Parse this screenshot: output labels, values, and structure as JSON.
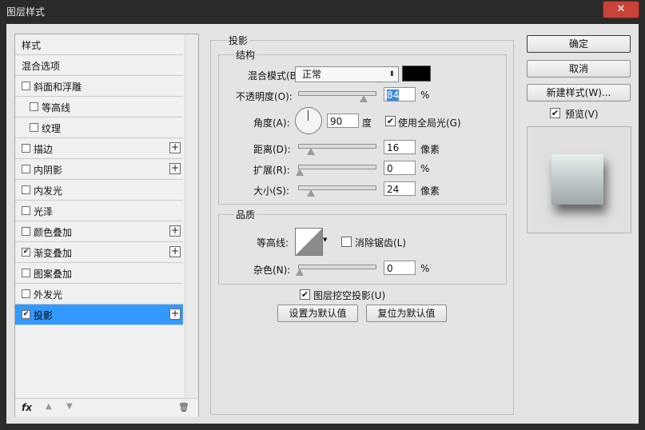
{
  "window": {
    "title": "图层样式",
    "close_label": "✕"
  },
  "left_panel": {
    "items": [
      {
        "label": "样式",
        "checkbox": false,
        "checked": false,
        "plus": false,
        "indent": 0,
        "selected": false
      },
      {
        "label": "混合选项",
        "checkbox": false,
        "checked": false,
        "plus": false,
        "indent": 0,
        "selected": false
      },
      {
        "label": "斜面和浮雕",
        "checkbox": true,
        "checked": false,
        "plus": false,
        "indent": 0,
        "selected": false
      },
      {
        "label": "等高线",
        "checkbox": true,
        "checked": false,
        "plus": false,
        "indent": 1,
        "selected": false
      },
      {
        "label": "纹理",
        "checkbox": true,
        "checked": false,
        "plus": false,
        "indent": 1,
        "selected": false
      },
      {
        "label": "描边",
        "checkbox": true,
        "checked": false,
        "plus": true,
        "indent": 0,
        "selected": false
      },
      {
        "label": "内阴影",
        "checkbox": true,
        "checked": false,
        "plus": true,
        "indent": 0,
        "selected": false
      },
      {
        "label": "内发光",
        "checkbox": true,
        "checked": false,
        "plus": false,
        "indent": 0,
        "selected": false
      },
      {
        "label": "光泽",
        "checkbox": true,
        "checked": false,
        "plus": false,
        "indent": 0,
        "selected": false
      },
      {
        "label": "颜色叠加",
        "checkbox": true,
        "checked": false,
        "plus": true,
        "indent": 0,
        "selected": false
      },
      {
        "label": "渐变叠加",
        "checkbox": true,
        "checked": true,
        "plus": true,
        "indent": 0,
        "selected": false
      },
      {
        "label": "图案叠加",
        "checkbox": true,
        "checked": false,
        "plus": false,
        "indent": 0,
        "selected": false
      },
      {
        "label": "外发光",
        "checkbox": true,
        "checked": false,
        "plus": false,
        "indent": 0,
        "selected": false
      },
      {
        "label": "投影",
        "checkbox": true,
        "checked": true,
        "plus": true,
        "indent": 0,
        "selected": true
      }
    ],
    "plus_label": "+",
    "check_mark": "✔",
    "bottom": {
      "fx_label": "fx",
      "up_icon": "▲",
      "down_icon": "▼",
      "trash_icon": "🗑"
    }
  },
  "drop_shadow": {
    "section_title": "投影",
    "structure_title": "结构",
    "blend_mode_label": "混合模式(B):",
    "blend_mode_value": "正常",
    "blend_color": "#000000",
    "opacity_label": "不透明度(O):",
    "opacity_value": "84",
    "opacity_unit": "%",
    "opacity_level": 0.84,
    "angle_label": "角度(A):",
    "angle_value": "90",
    "angle_unit": "度",
    "global_light_label": "使用全局光(G)",
    "global_light_checked": true,
    "distance_label": "距离(D):",
    "distance_value": "16",
    "distance_unit": "像素",
    "spread_label": "扩展(R):",
    "spread_value": "0",
    "spread_unit": "%",
    "size_label": "大小(S):",
    "size_value": "24",
    "size_unit": "像素",
    "quality_title": "品质",
    "contour_label": "等高线:",
    "anti_alias_label": "消除锯齿(L)",
    "noise_label": "杂色(N):",
    "noise_value": "0",
    "noise_unit": "%",
    "knockout_label": "图层挖空投影(U)",
    "knockout_checked": true,
    "set_default_label": "设置为默认值",
    "reset_default_label": "复位为默认值"
  },
  "right_panel": {
    "ok_label": "确定",
    "cancel_label": "取消",
    "new_style_label": "新建样式(W)...",
    "preview_label": "预览(V)",
    "preview_checked": true
  }
}
